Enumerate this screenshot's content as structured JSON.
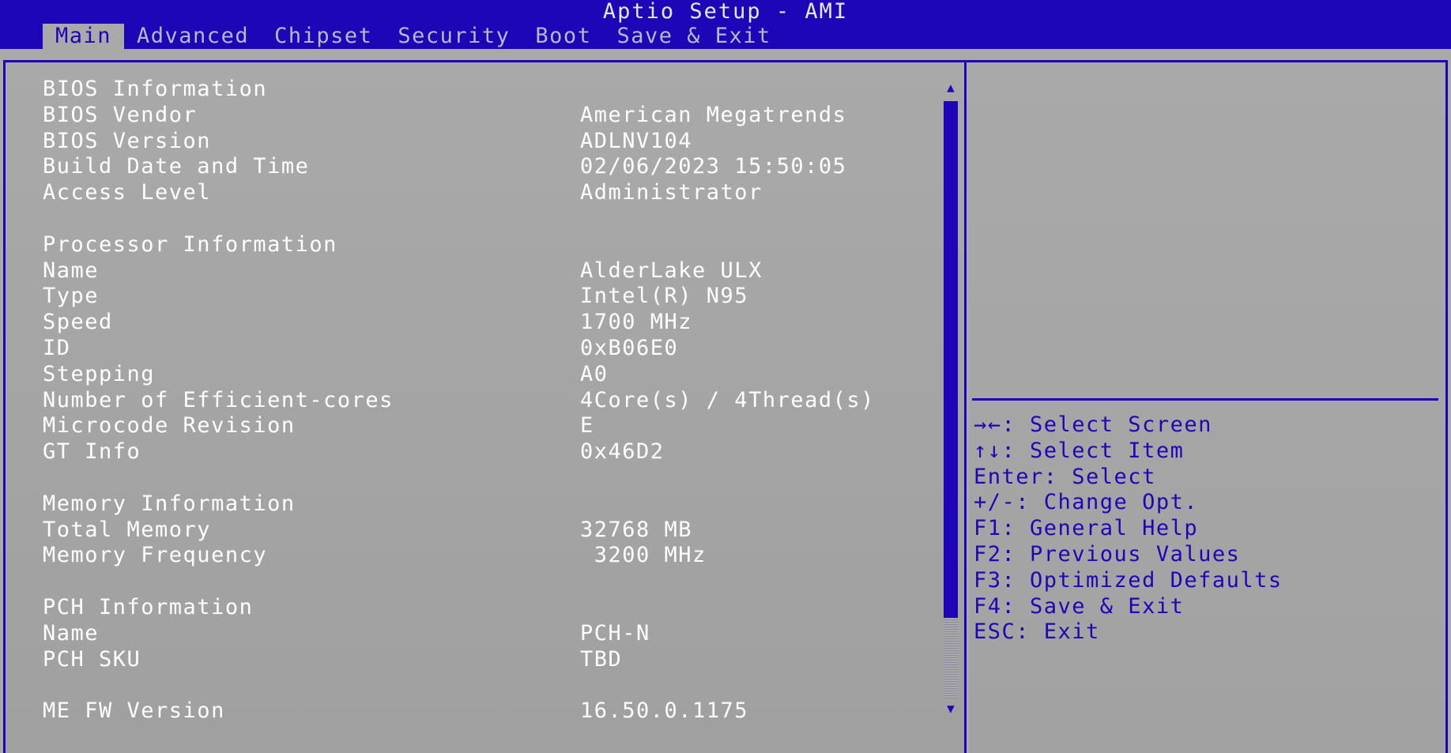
{
  "title": "Aptio Setup - AMI",
  "tabs": [
    {
      "label": "Main",
      "active": true
    },
    {
      "label": "Advanced"
    },
    {
      "label": "Chipset"
    },
    {
      "label": "Security"
    },
    {
      "label": "Boot"
    },
    {
      "label": "Save & Exit"
    }
  ],
  "rows": [
    {
      "label": "BIOS Information",
      "value": ""
    },
    {
      "label": "BIOS Vendor",
      "value": "American Megatrends"
    },
    {
      "label": "BIOS Version",
      "value": "ADLNV104"
    },
    {
      "label": "Build Date and Time",
      "value": "02/06/2023 15:50:05"
    },
    {
      "label": "Access Level",
      "value": "Administrator"
    },
    {
      "label": "",
      "value": ""
    },
    {
      "label": "Processor Information",
      "value": ""
    },
    {
      "label": "Name",
      "value": "AlderLake ULX"
    },
    {
      "label": "Type",
      "value": "Intel(R) N95"
    },
    {
      "label": "Speed",
      "value": "1700 MHz"
    },
    {
      "label": "ID",
      "value": "0xB06E0"
    },
    {
      "label": "Stepping",
      "value": "A0"
    },
    {
      "label": "Number of Efficient-cores",
      "value": "4Core(s) / 4Thread(s)"
    },
    {
      "label": "Microcode Revision",
      "value": "E"
    },
    {
      "label": "GT Info",
      "value": "0x46D2"
    },
    {
      "label": "",
      "value": ""
    },
    {
      "label": "Memory Information",
      "value": ""
    },
    {
      "label": "Total Memory",
      "value": "32768 MB"
    },
    {
      "label": "Memory Frequency",
      "value": " 3200 MHz"
    },
    {
      "label": "",
      "value": ""
    },
    {
      "label": "PCH Information",
      "value": ""
    },
    {
      "label": "Name",
      "value": "PCH-N"
    },
    {
      "label": "PCH SKU",
      "value": "TBD"
    },
    {
      "label": "",
      "value": ""
    },
    {
      "label": "ME FW Version",
      "value": "16.50.0.1175"
    }
  ],
  "help": [
    "→←: Select Screen",
    "↑↓: Select Item",
    "Enter: Select",
    "+/-: Change Opt.",
    "F1: General Help",
    "F2: Previous Values",
    "F3: Optimized Defaults",
    "F4: Save & Exit",
    "ESC: Exit"
  ],
  "scroll": {
    "up_icon": "▲",
    "down_icon": "▼"
  },
  "colors": {
    "accent": "#1d06b8",
    "panel": "#a9a9a9",
    "text": "#ffffff"
  }
}
